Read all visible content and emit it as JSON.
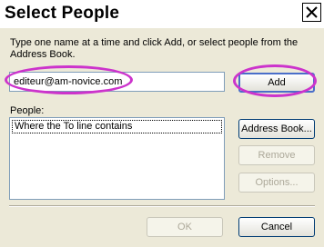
{
  "window": {
    "title": "Select People",
    "close_icon": "close-icon"
  },
  "instructions": "Type one name at a time and click Add, or select people from the Address Book.",
  "name_input": {
    "value": "editeur@am-novice.com"
  },
  "buttons": {
    "add": "Add",
    "address_book": "Address Book...",
    "remove": "Remove",
    "options": "Options...",
    "ok": "OK",
    "cancel": "Cancel"
  },
  "people": {
    "label": "People:",
    "items": [
      "Where the To line contains"
    ]
  },
  "colors": {
    "highlight_annotation": "#cc33cc",
    "dialog_background": "#ece9d8"
  }
}
